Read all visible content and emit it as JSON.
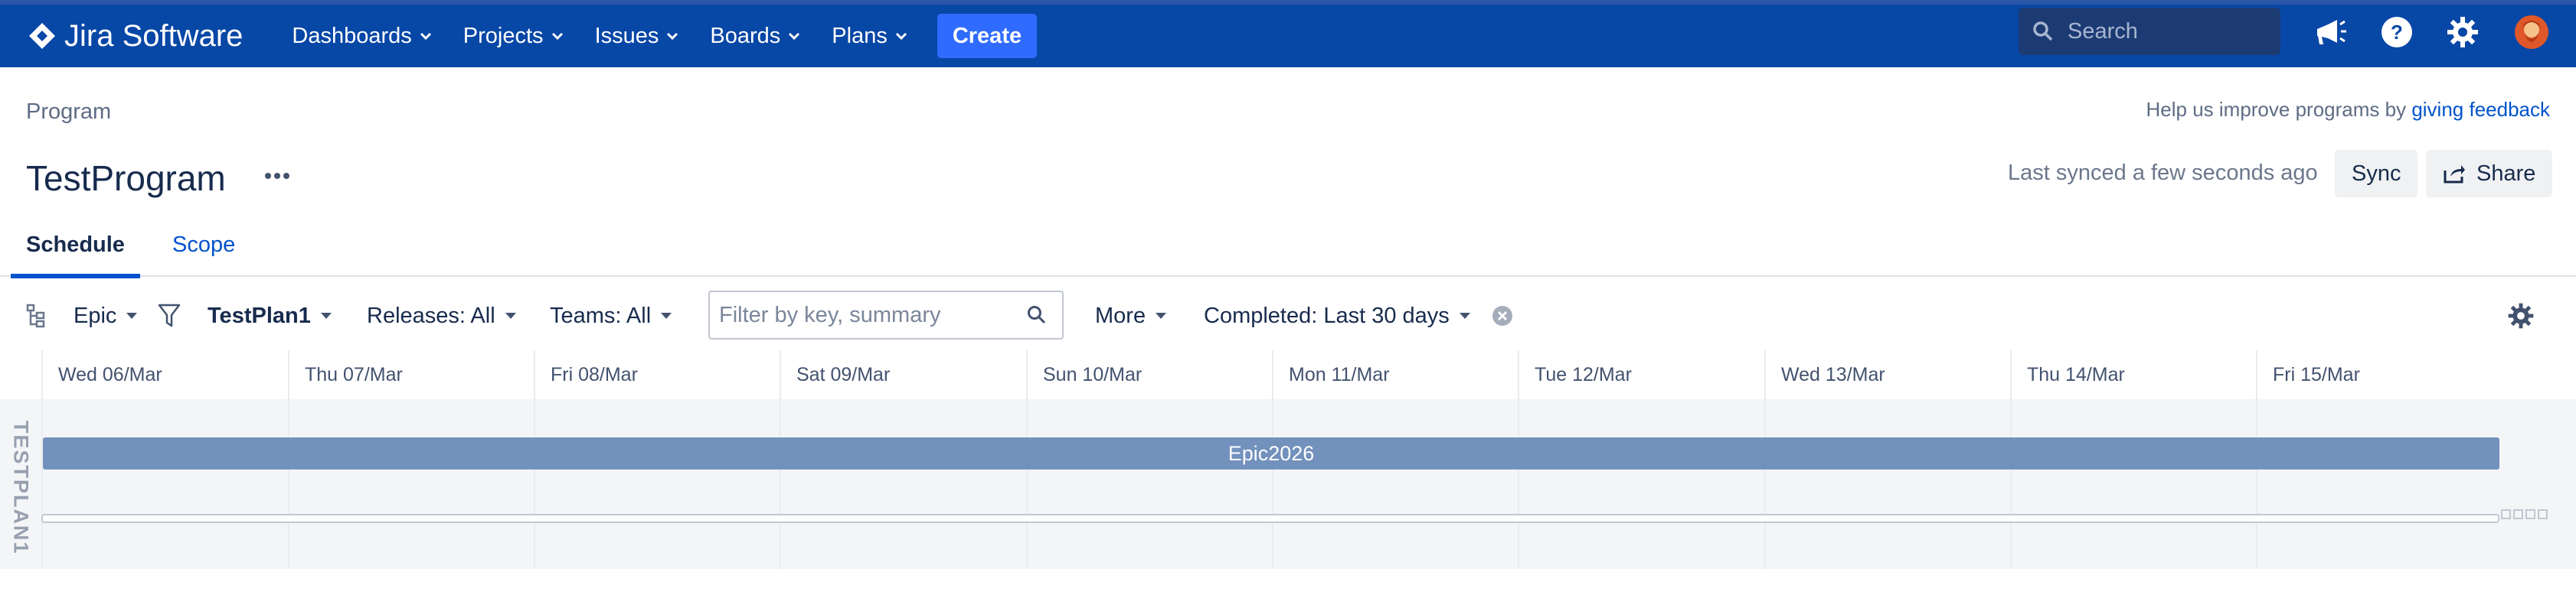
{
  "topnav": {
    "brand": "Jira Software",
    "items": [
      {
        "label": "Dashboards"
      },
      {
        "label": "Projects"
      },
      {
        "label": "Issues"
      },
      {
        "label": "Boards"
      },
      {
        "label": "Plans"
      }
    ],
    "create_label": "Create",
    "search_placeholder": "Search",
    "icons": [
      "megaphone-icon",
      "help-icon",
      "gear-icon",
      "avatar"
    ]
  },
  "page": {
    "breadcrumb": "Program",
    "feedback_text": "Help us improve programs by ",
    "feedback_link": "giving feedback",
    "title": "TestProgram",
    "sync_status": "Last synced a few seconds ago",
    "sync_label": "Sync",
    "share_label": "Share"
  },
  "tabs": [
    {
      "label": "Schedule",
      "active": true
    },
    {
      "label": "Scope",
      "active": false
    }
  ],
  "toolbar": {
    "hierarchy": "Epic",
    "plan": "TestPlan1",
    "releases": "Releases: All",
    "teams": "Teams: All",
    "filter_placeholder": "Filter by key, summary",
    "more": "More",
    "completed": "Completed: Last 30 days"
  },
  "timeline": {
    "dates": [
      "Wed 06/Mar",
      "Thu 07/Mar",
      "Fri 08/Mar",
      "Sat 09/Mar",
      "Sun 10/Mar",
      "Mon 11/Mar",
      "Tue 12/Mar",
      "Wed 13/Mar",
      "Thu 14/Mar",
      "Fri 15/Mar"
    ],
    "row_label": "TESTPLAN1",
    "epic_label": "Epic2026"
  },
  "colors": {
    "nav_bg": "#0747a6",
    "create_bg": "#2f6bff",
    "epic_bar": "#7391bd",
    "link": "#0052cc",
    "avatar": "#e0582a"
  }
}
